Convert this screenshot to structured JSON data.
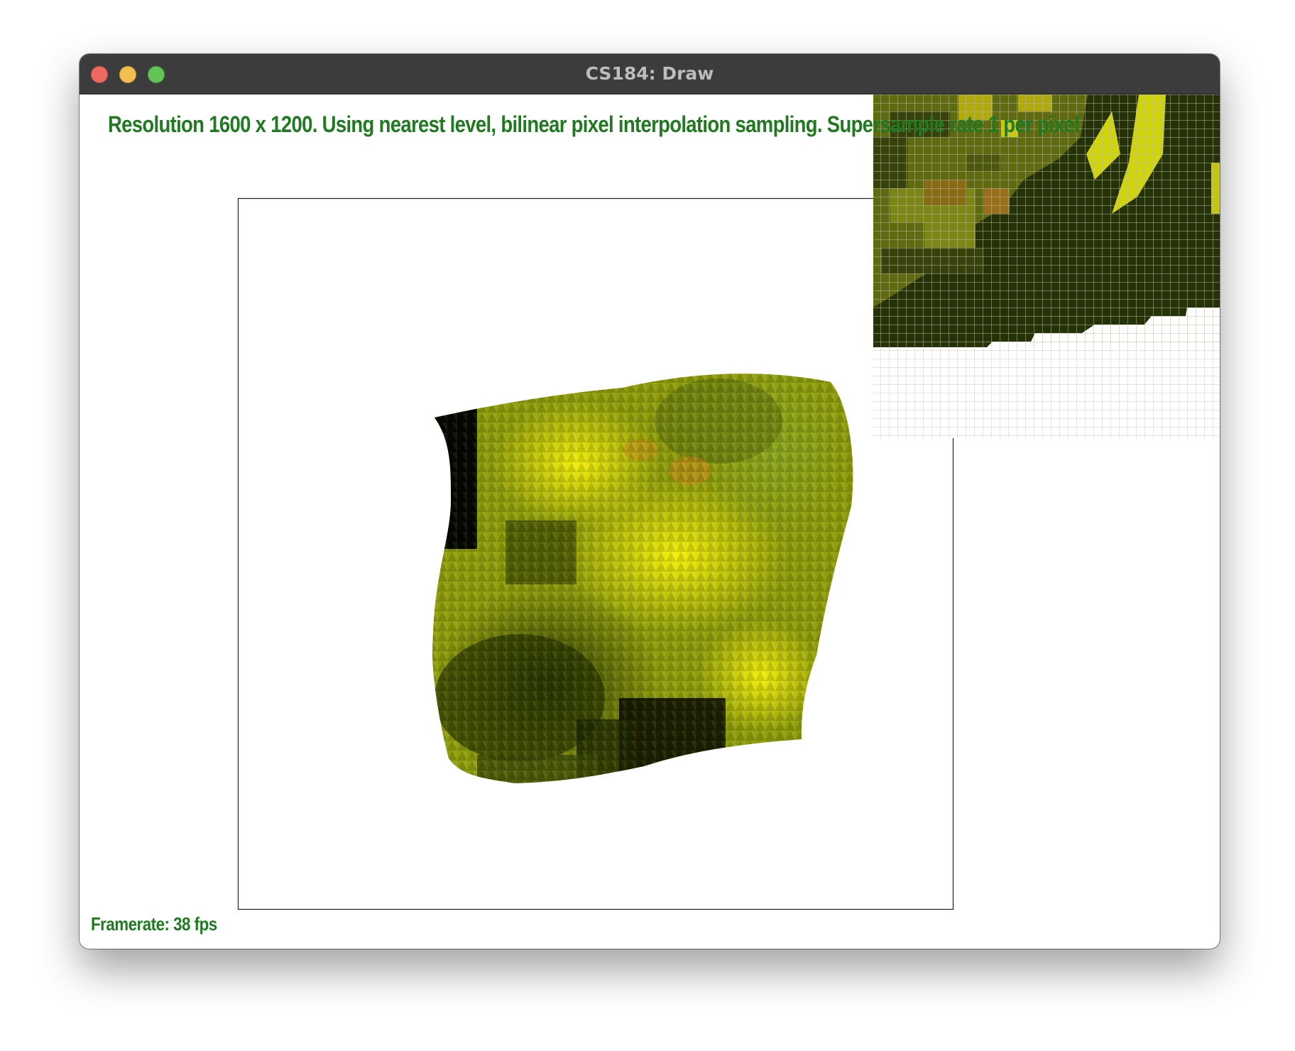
{
  "window": {
    "title": "CS184: Draw"
  },
  "status": {
    "text": "Resolution 1600 x 1200. Using nearest level, bilinear pixel interpolation sampling. Supersample rate 1 per pixel"
  },
  "framerate": {
    "text": "Framerate: 38 fps"
  },
  "colors": {
    "status_text": "#217a21",
    "titlebar": "#3c3c3c",
    "texture_dark": "#2b3a05",
    "texture_mid": "#7d8e0a",
    "texture_bright": "#d6dc07",
    "zoom_grid_line": "#c8c8c8"
  },
  "icons": {
    "close": "close-traffic-light-icon",
    "minimize": "minimize-traffic-light-icon",
    "zoom": "zoom-traffic-light-icon"
  }
}
